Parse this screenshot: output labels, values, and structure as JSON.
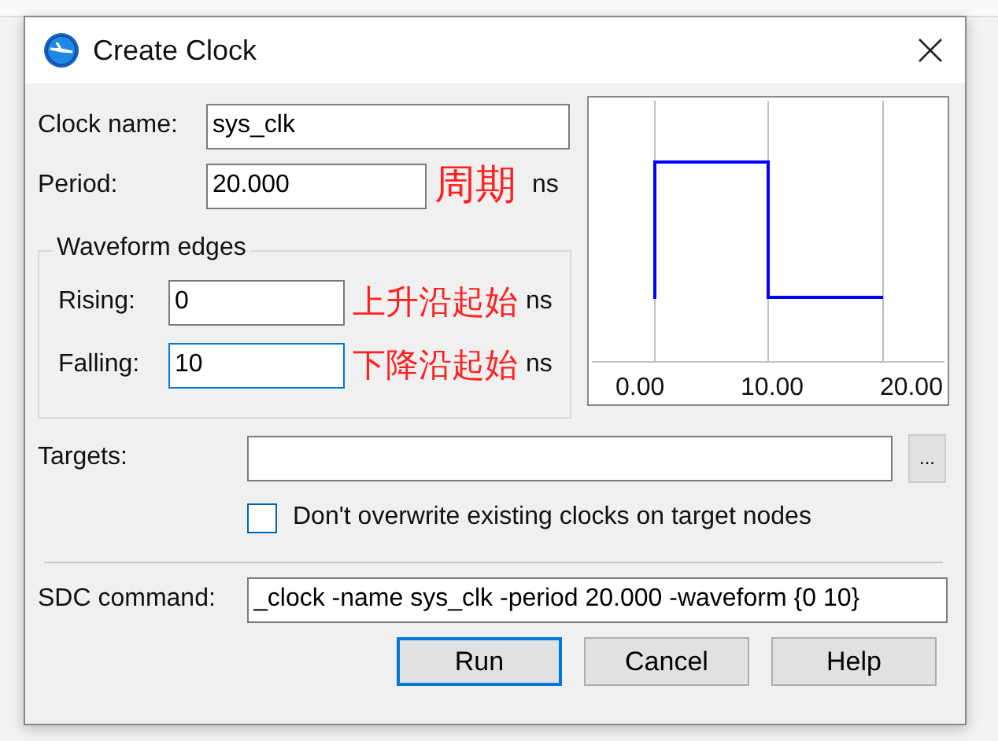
{
  "window": {
    "title": "Create Clock"
  },
  "clock_name": {
    "label": "Clock name:",
    "value": "sys_clk"
  },
  "period": {
    "label": "Period:",
    "value": "20.000",
    "unit": "ns"
  },
  "waveform_edges": {
    "title": "Waveform edges",
    "fields": [
      {
        "label": "Rising:",
        "value": "0",
        "unit": "ns",
        "focused": false
      },
      {
        "label": "Falling:",
        "value": "10",
        "unit": "ns",
        "focused": true
      }
    ]
  },
  "preview": {
    "tick_labels": [
      "0.00",
      "10.00",
      "20.00"
    ]
  },
  "targets": {
    "label": "Targets:",
    "browse_button": "..."
  },
  "dont_overwrite": {
    "label": "Don't overwrite existing clocks on target nodes",
    "checked": false
  },
  "sdc_command": {
    "label": "SDC command:",
    "value": "_clock -name sys_clk -period 20.000 -waveform {0 10}"
  },
  "buttons": [
    {
      "label": "Run",
      "default": true
    },
    {
      "label": "Cancel",
      "default": false
    },
    {
      "label": "Help",
      "default": false
    }
  ],
  "annotations": [
    "周期",
    "上升沿起始",
    "下降沿起始"
  ]
}
